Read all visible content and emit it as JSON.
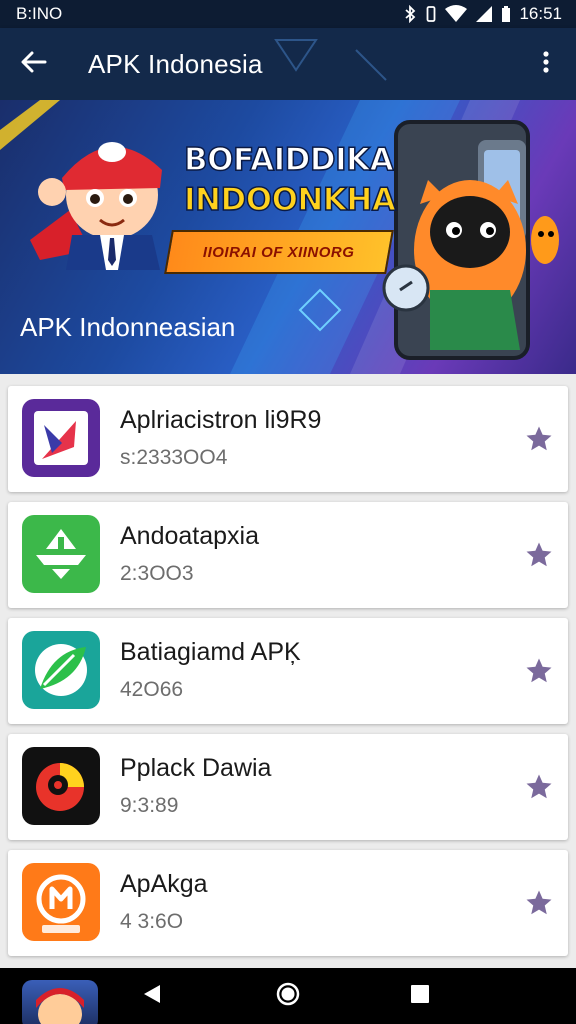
{
  "status_bar": {
    "left_text": "B:INO",
    "time": "16:51"
  },
  "app_bar": {
    "title": "APK Indonesia",
    "back_icon": "arrow-left-icon",
    "menu_icon": "more-vertical-icon"
  },
  "banner": {
    "title_line1": "BOFAIDDIKA",
    "title_line2": "INDOONKHA",
    "ribbon": "IIOIRAI OF XIINORG",
    "caption": "APK Indonneasian"
  },
  "apps": [
    {
      "name": "Aplriacistron li9R9",
      "meta": "s:2333OO4",
      "icon": "purple-arrow-icon",
      "color": "#5a2a9a"
    },
    {
      "name": "Andoatapxia",
      "meta": "2:3OO3",
      "icon": "green-boat-icon",
      "color": "#3cb84a"
    },
    {
      "name": "Batiagiamd APĶ",
      "meta": "42O66",
      "icon": "teal-leaf-icon",
      "color": "#1aa59a"
    },
    {
      "name": "Pplack Dawia",
      "meta": "9:3:89",
      "icon": "black-circle-icon",
      "color": "#111111"
    },
    {
      "name": "ApAkga",
      "meta": "4 3:6O",
      "icon": "orange-m-icon",
      "color": "#ff7a18"
    }
  ],
  "colors": {
    "app_bar": "#13294a",
    "star": "#7b6a9c"
  }
}
